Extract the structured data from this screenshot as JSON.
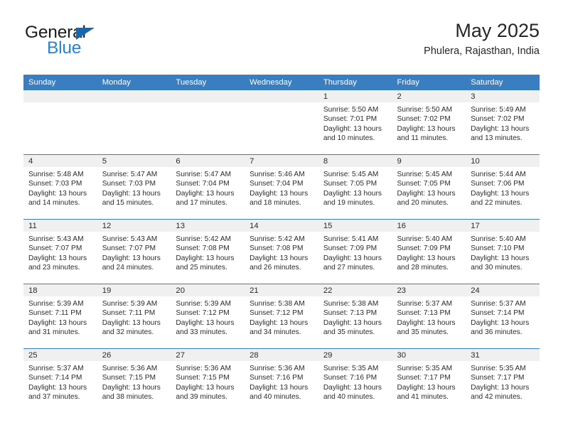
{
  "brand": {
    "word_one": "General",
    "word_two": "Blue",
    "triangle_color": "#1667b2",
    "blue_color": "#2683d6"
  },
  "header": {
    "title": "May 2025",
    "subtitle": "Phulera, Rajasthan, India"
  },
  "theme": {
    "header_blue": "#3a7dc0",
    "daynum_band": "#f0f0f0",
    "text": "#2b2b2b"
  },
  "weekdays": [
    "Sunday",
    "Monday",
    "Tuesday",
    "Wednesday",
    "Thursday",
    "Friday",
    "Saturday"
  ],
  "weeks": [
    [
      {
        "day": "",
        "empty": true
      },
      {
        "day": "",
        "empty": true
      },
      {
        "day": "",
        "empty": true
      },
      {
        "day": "",
        "empty": true
      },
      {
        "day": "1",
        "sunrise": "Sunrise: 5:50 AM",
        "sunset": "Sunset: 7:01 PM",
        "daylight_line1": "Daylight: 13 hours",
        "daylight_line2": "and 10 minutes."
      },
      {
        "day": "2",
        "sunrise": "Sunrise: 5:50 AM",
        "sunset": "Sunset: 7:02 PM",
        "daylight_line1": "Daylight: 13 hours",
        "daylight_line2": "and 11 minutes."
      },
      {
        "day": "3",
        "sunrise": "Sunrise: 5:49 AM",
        "sunset": "Sunset: 7:02 PM",
        "daylight_line1": "Daylight: 13 hours",
        "daylight_line2": "and 13 minutes."
      }
    ],
    [
      {
        "day": "4",
        "sunrise": "Sunrise: 5:48 AM",
        "sunset": "Sunset: 7:03 PM",
        "daylight_line1": "Daylight: 13 hours",
        "daylight_line2": "and 14 minutes."
      },
      {
        "day": "5",
        "sunrise": "Sunrise: 5:47 AM",
        "sunset": "Sunset: 7:03 PM",
        "daylight_line1": "Daylight: 13 hours",
        "daylight_line2": "and 15 minutes."
      },
      {
        "day": "6",
        "sunrise": "Sunrise: 5:47 AM",
        "sunset": "Sunset: 7:04 PM",
        "daylight_line1": "Daylight: 13 hours",
        "daylight_line2": "and 17 minutes."
      },
      {
        "day": "7",
        "sunrise": "Sunrise: 5:46 AM",
        "sunset": "Sunset: 7:04 PM",
        "daylight_line1": "Daylight: 13 hours",
        "daylight_line2": "and 18 minutes."
      },
      {
        "day": "8",
        "sunrise": "Sunrise: 5:45 AM",
        "sunset": "Sunset: 7:05 PM",
        "daylight_line1": "Daylight: 13 hours",
        "daylight_line2": "and 19 minutes."
      },
      {
        "day": "9",
        "sunrise": "Sunrise: 5:45 AM",
        "sunset": "Sunset: 7:05 PM",
        "daylight_line1": "Daylight: 13 hours",
        "daylight_line2": "and 20 minutes."
      },
      {
        "day": "10",
        "sunrise": "Sunrise: 5:44 AM",
        "sunset": "Sunset: 7:06 PM",
        "daylight_line1": "Daylight: 13 hours",
        "daylight_line2": "and 22 minutes."
      }
    ],
    [
      {
        "day": "11",
        "sunrise": "Sunrise: 5:43 AM",
        "sunset": "Sunset: 7:07 PM",
        "daylight_line1": "Daylight: 13 hours",
        "daylight_line2": "and 23 minutes."
      },
      {
        "day": "12",
        "sunrise": "Sunrise: 5:43 AM",
        "sunset": "Sunset: 7:07 PM",
        "daylight_line1": "Daylight: 13 hours",
        "daylight_line2": "and 24 minutes."
      },
      {
        "day": "13",
        "sunrise": "Sunrise: 5:42 AM",
        "sunset": "Sunset: 7:08 PM",
        "daylight_line1": "Daylight: 13 hours",
        "daylight_line2": "and 25 minutes."
      },
      {
        "day": "14",
        "sunrise": "Sunrise: 5:42 AM",
        "sunset": "Sunset: 7:08 PM",
        "daylight_line1": "Daylight: 13 hours",
        "daylight_line2": "and 26 minutes."
      },
      {
        "day": "15",
        "sunrise": "Sunrise: 5:41 AM",
        "sunset": "Sunset: 7:09 PM",
        "daylight_line1": "Daylight: 13 hours",
        "daylight_line2": "and 27 minutes."
      },
      {
        "day": "16",
        "sunrise": "Sunrise: 5:40 AM",
        "sunset": "Sunset: 7:09 PM",
        "daylight_line1": "Daylight: 13 hours",
        "daylight_line2": "and 28 minutes."
      },
      {
        "day": "17",
        "sunrise": "Sunrise: 5:40 AM",
        "sunset": "Sunset: 7:10 PM",
        "daylight_line1": "Daylight: 13 hours",
        "daylight_line2": "and 30 minutes."
      }
    ],
    [
      {
        "day": "18",
        "sunrise": "Sunrise: 5:39 AM",
        "sunset": "Sunset: 7:11 PM",
        "daylight_line1": "Daylight: 13 hours",
        "daylight_line2": "and 31 minutes."
      },
      {
        "day": "19",
        "sunrise": "Sunrise: 5:39 AM",
        "sunset": "Sunset: 7:11 PM",
        "daylight_line1": "Daylight: 13 hours",
        "daylight_line2": "and 32 minutes."
      },
      {
        "day": "20",
        "sunrise": "Sunrise: 5:39 AM",
        "sunset": "Sunset: 7:12 PM",
        "daylight_line1": "Daylight: 13 hours",
        "daylight_line2": "and 33 minutes."
      },
      {
        "day": "21",
        "sunrise": "Sunrise: 5:38 AM",
        "sunset": "Sunset: 7:12 PM",
        "daylight_line1": "Daylight: 13 hours",
        "daylight_line2": "and 34 minutes."
      },
      {
        "day": "22",
        "sunrise": "Sunrise: 5:38 AM",
        "sunset": "Sunset: 7:13 PM",
        "daylight_line1": "Daylight: 13 hours",
        "daylight_line2": "and 35 minutes."
      },
      {
        "day": "23",
        "sunrise": "Sunrise: 5:37 AM",
        "sunset": "Sunset: 7:13 PM",
        "daylight_line1": "Daylight: 13 hours",
        "daylight_line2": "and 35 minutes."
      },
      {
        "day": "24",
        "sunrise": "Sunrise: 5:37 AM",
        "sunset": "Sunset: 7:14 PM",
        "daylight_line1": "Daylight: 13 hours",
        "daylight_line2": "and 36 minutes."
      }
    ],
    [
      {
        "day": "25",
        "sunrise": "Sunrise: 5:37 AM",
        "sunset": "Sunset: 7:14 PM",
        "daylight_line1": "Daylight: 13 hours",
        "daylight_line2": "and 37 minutes."
      },
      {
        "day": "26",
        "sunrise": "Sunrise: 5:36 AM",
        "sunset": "Sunset: 7:15 PM",
        "daylight_line1": "Daylight: 13 hours",
        "daylight_line2": "and 38 minutes."
      },
      {
        "day": "27",
        "sunrise": "Sunrise: 5:36 AM",
        "sunset": "Sunset: 7:15 PM",
        "daylight_line1": "Daylight: 13 hours",
        "daylight_line2": "and 39 minutes."
      },
      {
        "day": "28",
        "sunrise": "Sunrise: 5:36 AM",
        "sunset": "Sunset: 7:16 PM",
        "daylight_line1": "Daylight: 13 hours",
        "daylight_line2": "and 40 minutes."
      },
      {
        "day": "29",
        "sunrise": "Sunrise: 5:35 AM",
        "sunset": "Sunset: 7:16 PM",
        "daylight_line1": "Daylight: 13 hours",
        "daylight_line2": "and 40 minutes."
      },
      {
        "day": "30",
        "sunrise": "Sunrise: 5:35 AM",
        "sunset": "Sunset: 7:17 PM",
        "daylight_line1": "Daylight: 13 hours",
        "daylight_line2": "and 41 minutes."
      },
      {
        "day": "31",
        "sunrise": "Sunrise: 5:35 AM",
        "sunset": "Sunset: 7:17 PM",
        "daylight_line1": "Daylight: 13 hours",
        "daylight_line2": "and 42 minutes."
      }
    ]
  ]
}
